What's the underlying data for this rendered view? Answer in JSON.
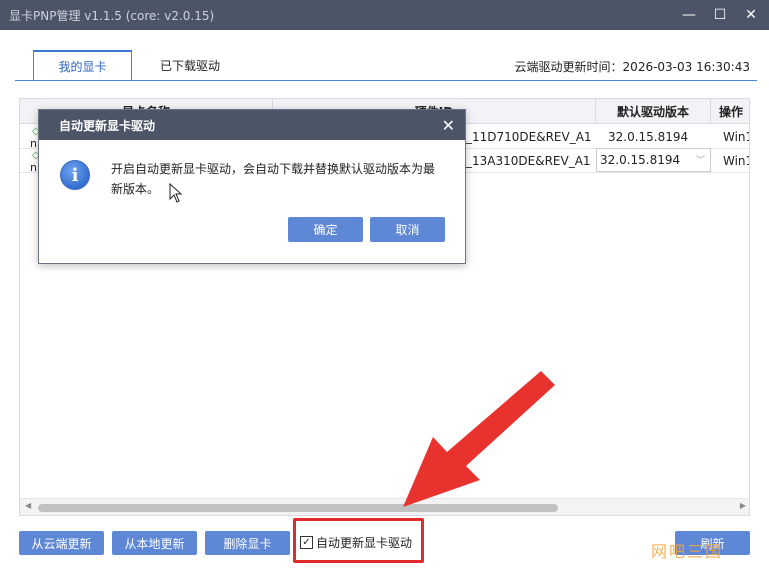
{
  "window": {
    "title": "显卡PNP管理 v1.1.5 (core: v2.0.15)",
    "controls": {
      "minimize": "—",
      "maximize": "☐",
      "close": "✕"
    }
  },
  "tabs": [
    {
      "label": "我的显卡",
      "active": true
    },
    {
      "label": "已下载驱动",
      "active": false
    }
  ],
  "update_time": "云端驱动更新时间：2026-03-03 16:30:43",
  "table": {
    "headers": [
      "显卡名称",
      "硬件ID",
      "默认驱动版本",
      "操作"
    ],
    "rows": [
      {
        "prefix": "n",
        "hwid": "_11D710DE&REV_A1",
        "version": "32.0.15.8194",
        "os": "Win1"
      },
      {
        "prefix": "n",
        "hwid": "_13A310DE&REV_A1",
        "version": "32.0.15.8194",
        "os": "Win1"
      }
    ]
  },
  "buttons": {
    "cloud_update": "从云端更新",
    "local_update": "从本地更新",
    "delete": "删除显卡",
    "refresh": "刷新"
  },
  "auto_update": {
    "label": "自动更新显卡驱动",
    "checked": true,
    "check_mark": "✓"
  },
  "dialog": {
    "title": "自动更新显卡驱动",
    "close": "✕",
    "icon_glyph": "i",
    "message": "开启自动更新显卡驱动，会自动下载并替换默认驱动版本为最新版本。",
    "ok": "确定",
    "cancel": "取消"
  },
  "watermark": "网吧三国",
  "colors": {
    "titlebar": "#4b5567",
    "button": "#5e87d6",
    "highlight": "#e22a2a",
    "accent": "#3a78d4"
  }
}
